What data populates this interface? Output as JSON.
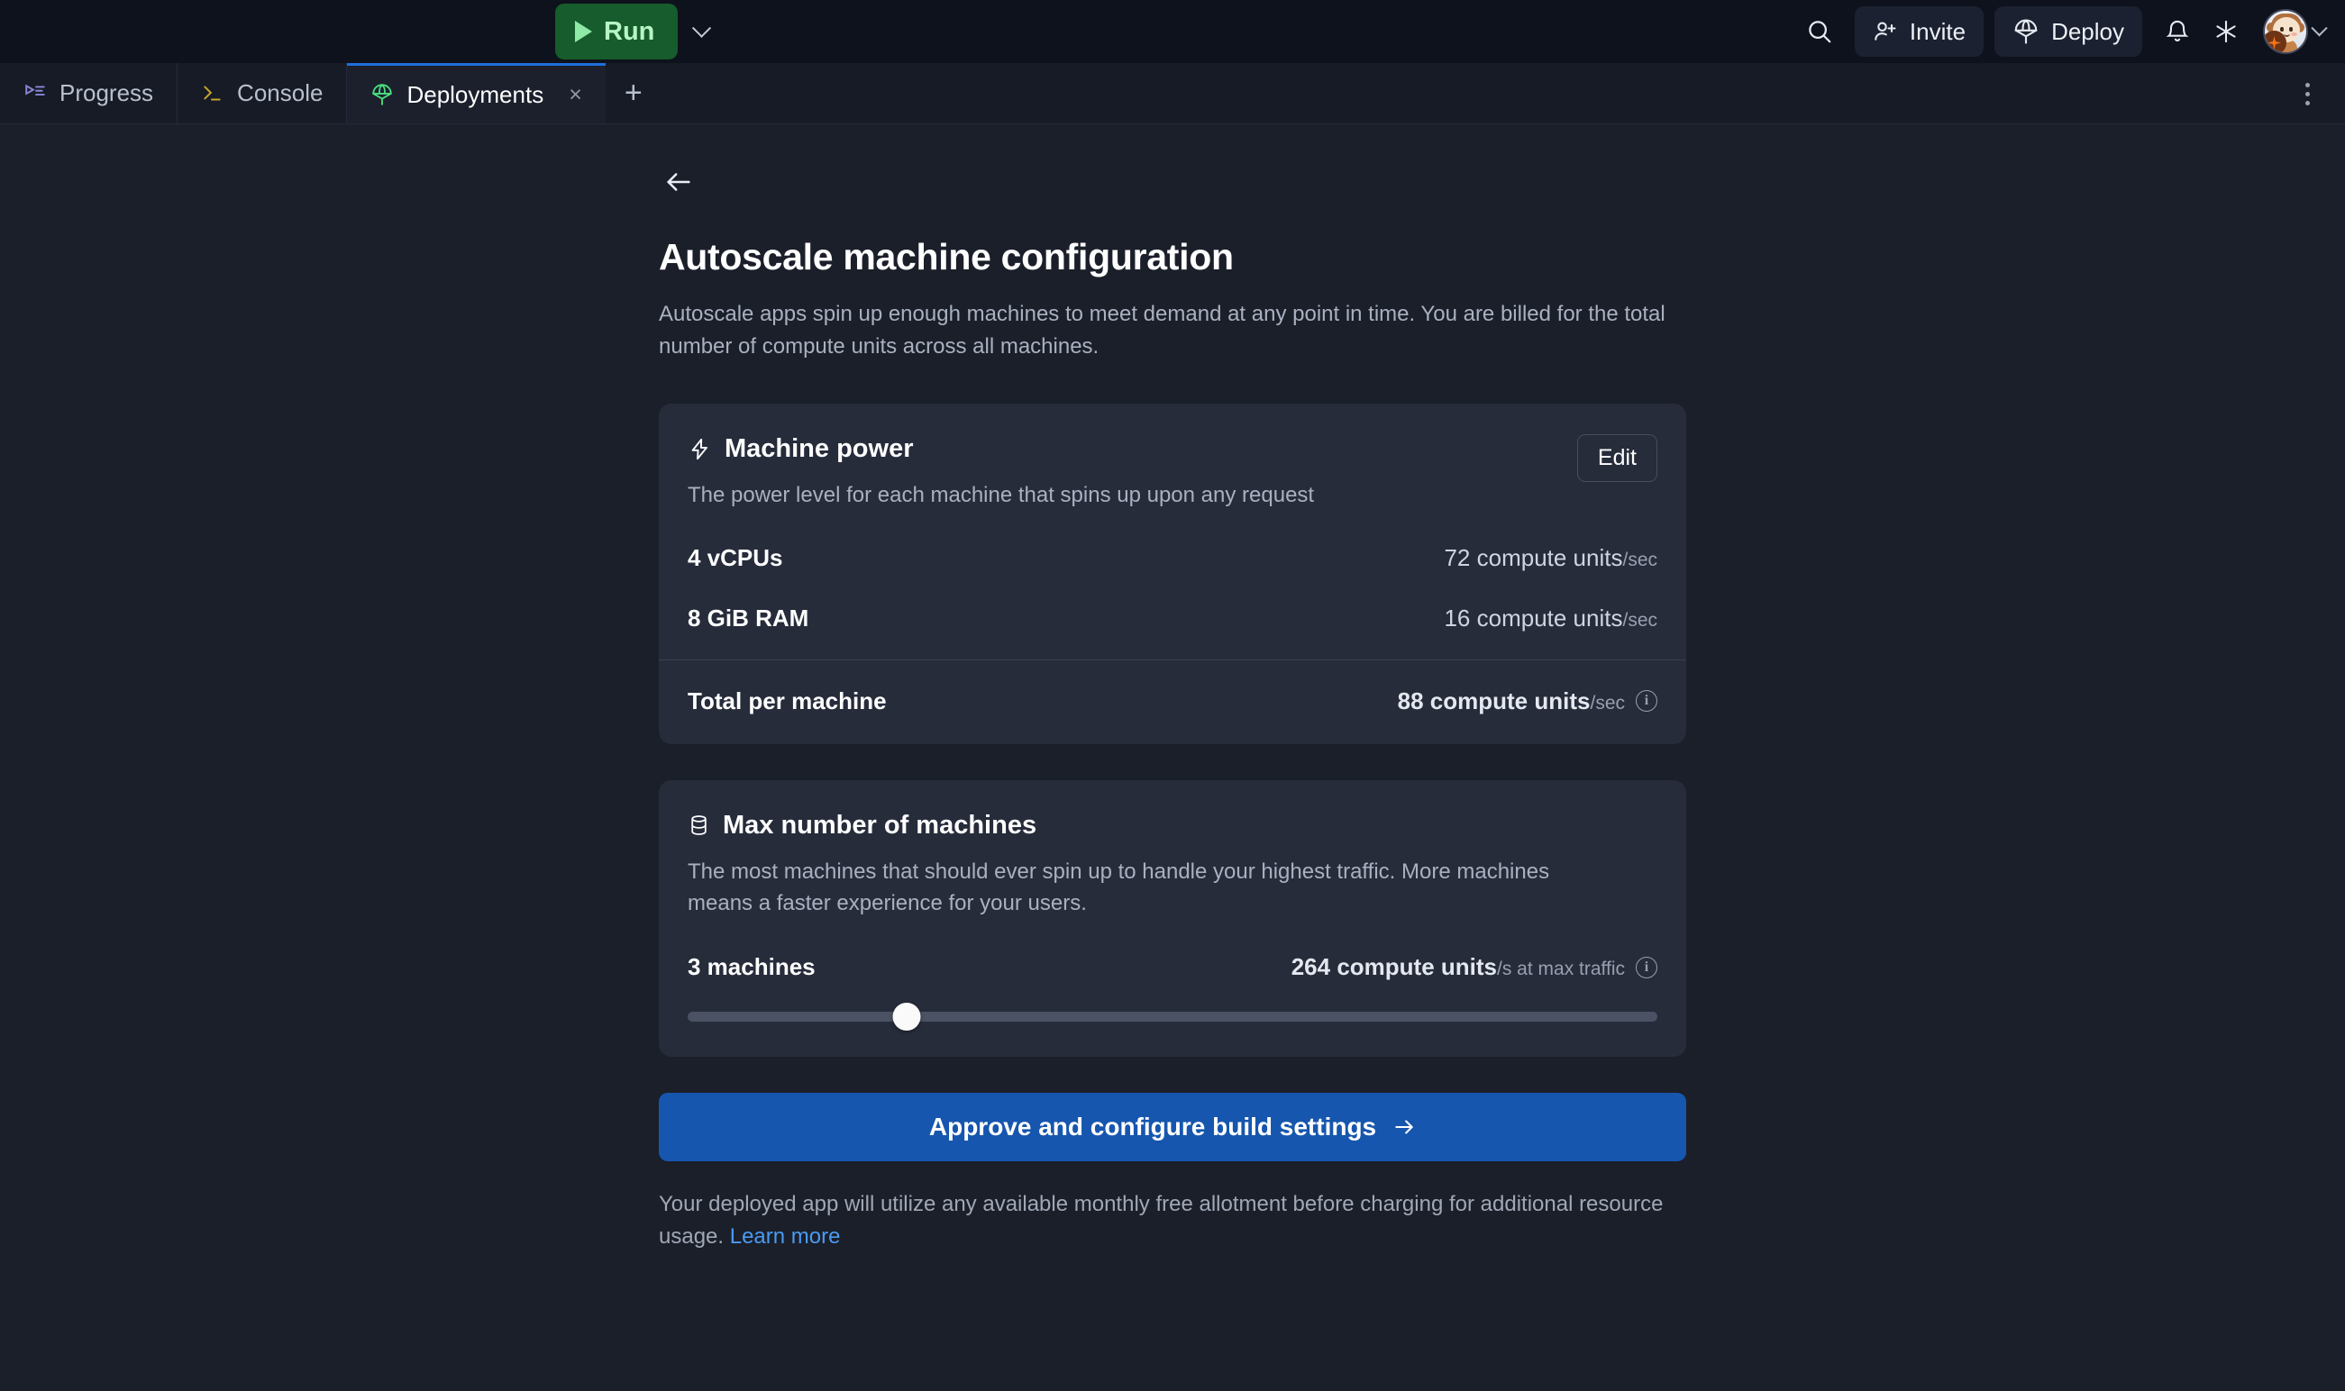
{
  "header": {
    "run_label": "Run",
    "run_caret_icon": "chevron-down-icon",
    "search_icon": "search-icon",
    "invite_label": "Invite",
    "invite_icon": "user-plus-icon",
    "deploy_label": "Deploy",
    "deploy_icon": "parachute-icon",
    "bell_icon": "bell-icon",
    "sparkle_icon": "asterisk-icon",
    "avatar_icon": "user-avatar",
    "avatar_caret_icon": "chevron-down-icon",
    "accent_run_bg": "#165c2c",
    "accent_run_fg": "#b8f5c4"
  },
  "tabs": {
    "items": [
      {
        "label": "Progress",
        "icon": "progress-icon",
        "active": false,
        "closable": false
      },
      {
        "label": "Console",
        "icon": "terminal-icon",
        "active": false,
        "closable": false
      },
      {
        "label": "Deployments",
        "icon": "parachute-icon",
        "active": true,
        "closable": true
      }
    ],
    "close_glyph": "×",
    "add_glyph": "+",
    "overflow_icon": "kebab-menu-icon",
    "active_indicator_color": "#1f6fdb"
  },
  "main": {
    "back_icon": "arrow-left-icon",
    "title": "Autoscale machine configuration",
    "description": "Autoscale apps spin up enough machines to meet demand at any point in time. You are billed for the total number of compute units across all machines.",
    "machine_power": {
      "icon": "lightning-bolt-icon",
      "title": "Machine power",
      "edit_label": "Edit",
      "description": "The power level for each machine that spins up upon any request",
      "specs": [
        {
          "label": "4 vCPUs",
          "value": "72 compute units",
          "unit": "/sec"
        },
        {
          "label": "8 GiB RAM",
          "value": "16 compute units",
          "unit": "/sec"
        }
      ],
      "total_label": "Total per machine",
      "total_value": "88 compute units",
      "total_unit": "/sec",
      "total_info_icon": "info-icon"
    },
    "max_machines": {
      "icon": "database-icon",
      "title": "Max number of machines",
      "description": "The most machines that should ever spin up to handle your highest traffic. More machines means a faster experience for your users.",
      "count_label": "3 machines",
      "max_value": "264 compute units",
      "max_unit": "/s at max traffic",
      "max_info_icon": "info-icon",
      "slider": {
        "value": 3,
        "min": 1,
        "max": 10,
        "percent": 22.6
      }
    },
    "cta_label": "Approve and configure build settings",
    "cta_icon": "arrow-right-icon",
    "cta_color": "#1656ae",
    "footnote_text": "Your deployed app will utilize any available monthly free allotment before charging for additional resource usage. ",
    "footnote_link": "Learn more"
  }
}
